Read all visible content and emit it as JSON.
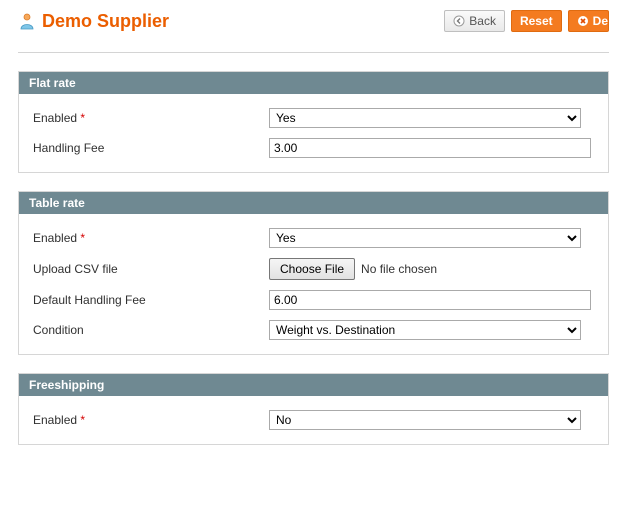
{
  "header": {
    "title": "Demo Supplier",
    "buttons": {
      "back": "Back",
      "reset": "Reset",
      "delete": "De"
    }
  },
  "sections": {
    "flat_rate": {
      "title": "Flat rate",
      "enabled_label": "Enabled",
      "enabled_value": "Yes",
      "handling_label": "Handling Fee",
      "handling_value": "3.00"
    },
    "table_rate": {
      "title": "Table rate",
      "enabled_label": "Enabled",
      "enabled_value": "Yes",
      "upload_label": "Upload CSV file",
      "choose_btn": "Choose File",
      "choose_status": "No file chosen",
      "default_handling_label": "Default Handling Fee",
      "default_handling_value": "6.00",
      "condition_label": "Condition",
      "condition_value": "Weight vs. Destination"
    },
    "freeshipping": {
      "title": "Freeshipping",
      "enabled_label": "Enabled",
      "enabled_value": "No"
    }
  }
}
